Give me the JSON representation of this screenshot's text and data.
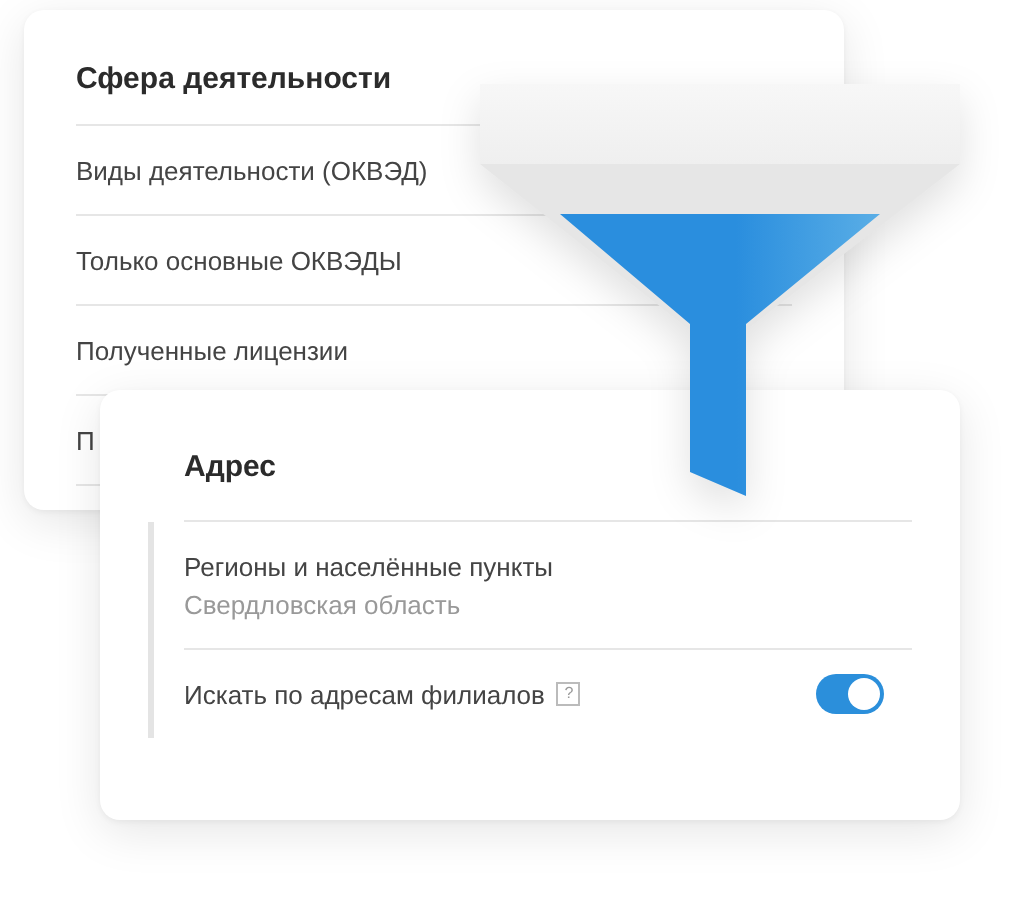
{
  "activity_card": {
    "title": "Сфера деятельности",
    "items": [
      "Виды деятельности (ОКВЭД)",
      "Только основные ОКВЭДЫ",
      "Полученные лицензии",
      "П"
    ]
  },
  "address_card": {
    "title": "Адрес",
    "fields": [
      {
        "kind": "value",
        "label": "Регионы и населённые пункты",
        "value": "Свердловская область"
      },
      {
        "kind": "toggle",
        "label": "Искать по адресам филиалов",
        "help": "?",
        "on": true
      }
    ]
  }
}
